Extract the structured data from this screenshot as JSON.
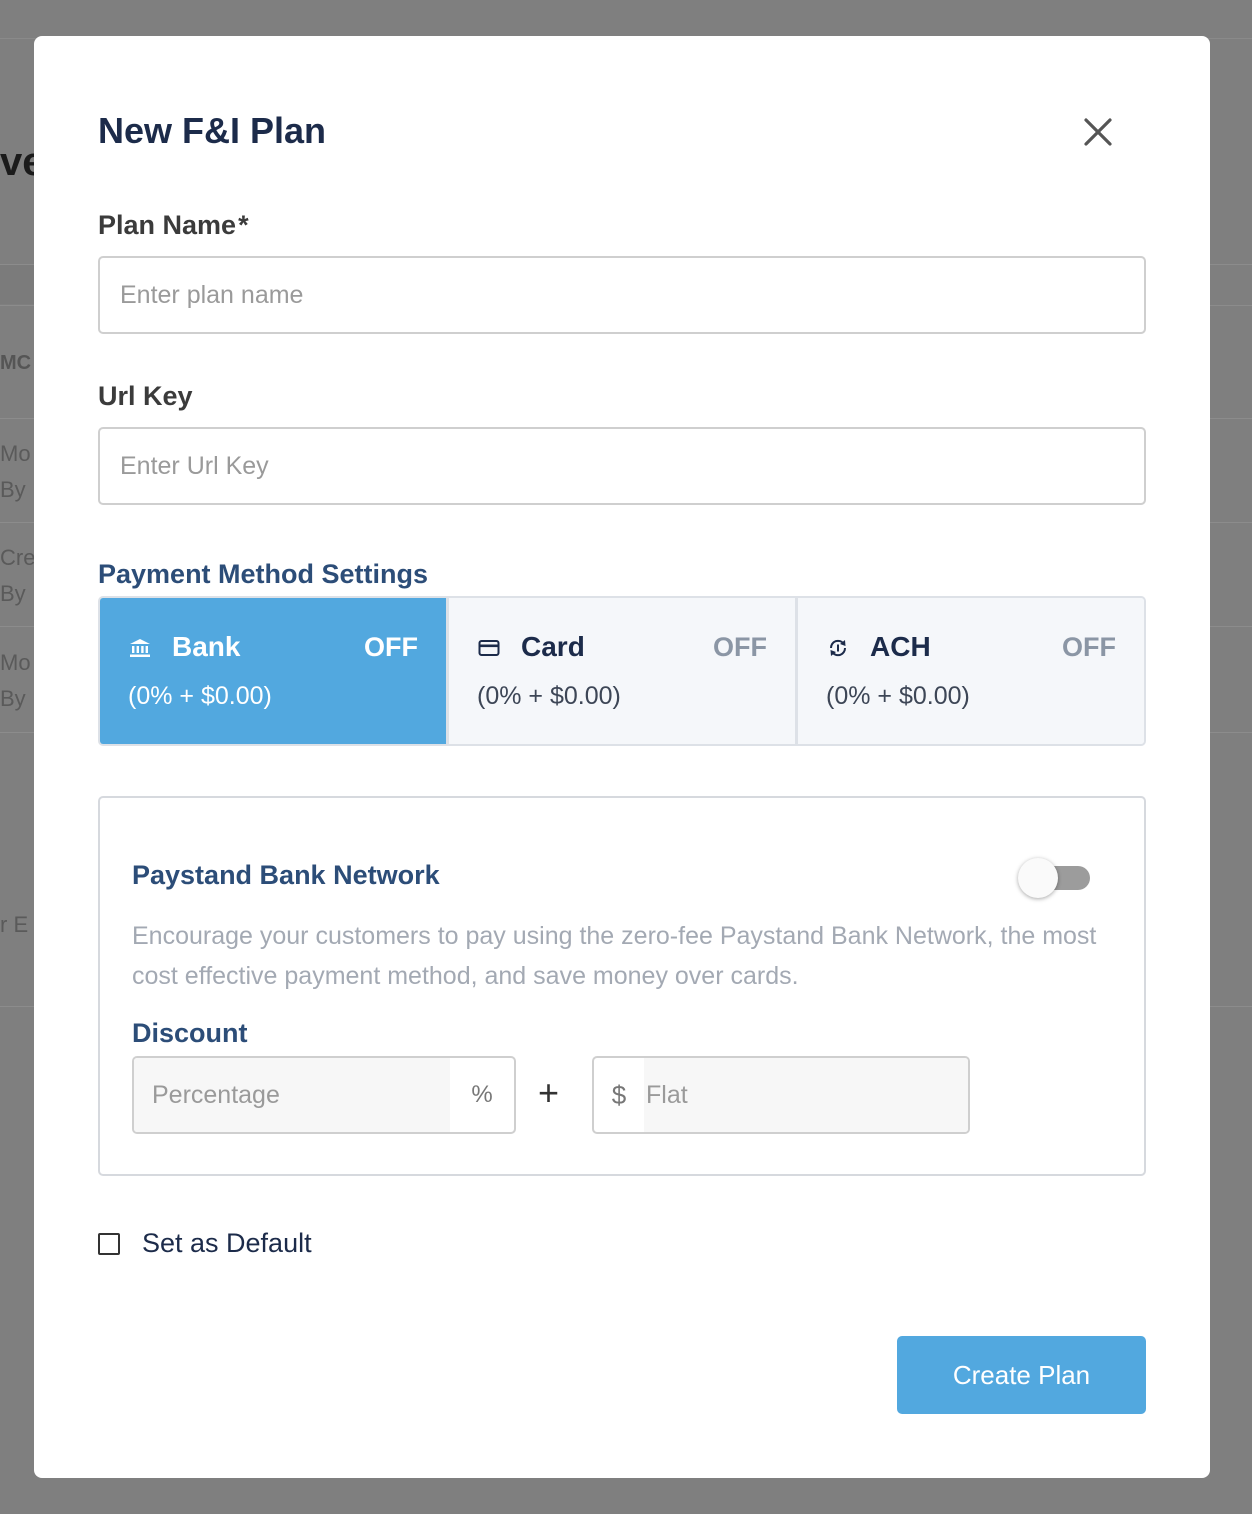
{
  "background": {
    "title_fragment": "ve",
    "column_fragment": "MC",
    "row_fragments": [
      "Mo",
      "By",
      "Cre",
      "By",
      "Mo",
      "By"
    ],
    "lower_fragment": "r E"
  },
  "modal": {
    "title": "New F&I Plan",
    "close_icon": "close-icon",
    "plan_name": {
      "label": "Plan Name",
      "required_mark": "*",
      "placeholder": "Enter plan name",
      "value": ""
    },
    "url_key": {
      "label": "Url Key",
      "placeholder": "Enter Url Key",
      "value": ""
    },
    "payment_methods": {
      "heading": "Payment Method Settings",
      "items": [
        {
          "name": "Bank",
          "icon": "bank-icon",
          "status": "OFF",
          "fee": "(0% + $0.00)",
          "selected": true
        },
        {
          "name": "Card",
          "icon": "credit-card-icon",
          "status": "OFF",
          "fee": "(0% + $0.00)",
          "selected": false
        },
        {
          "name": "ACH",
          "icon": "ach-transfer-icon",
          "status": "OFF",
          "fee": "(0% + $0.00)",
          "selected": false
        }
      ]
    },
    "bank_network": {
      "title": "Paystand Bank Network",
      "enabled": false,
      "description": "Encourage your customers to pay using the zero-fee Paystand Bank Network, the most cost effective payment method, and save money over cards.",
      "discount": {
        "label": "Discount",
        "percentage_placeholder": "Percentage",
        "percentage_unit": "%",
        "plus": "+",
        "flat_prefix": "$",
        "flat_placeholder": "Flat"
      }
    },
    "set_default": {
      "label": "Set as Default",
      "checked": false
    },
    "submit_label": "Create Plan"
  },
  "colors": {
    "overlay": "#7f7f7f",
    "accent": "#52a8df",
    "heading": "#1c2b4a",
    "section_heading": "#2c4d78"
  }
}
